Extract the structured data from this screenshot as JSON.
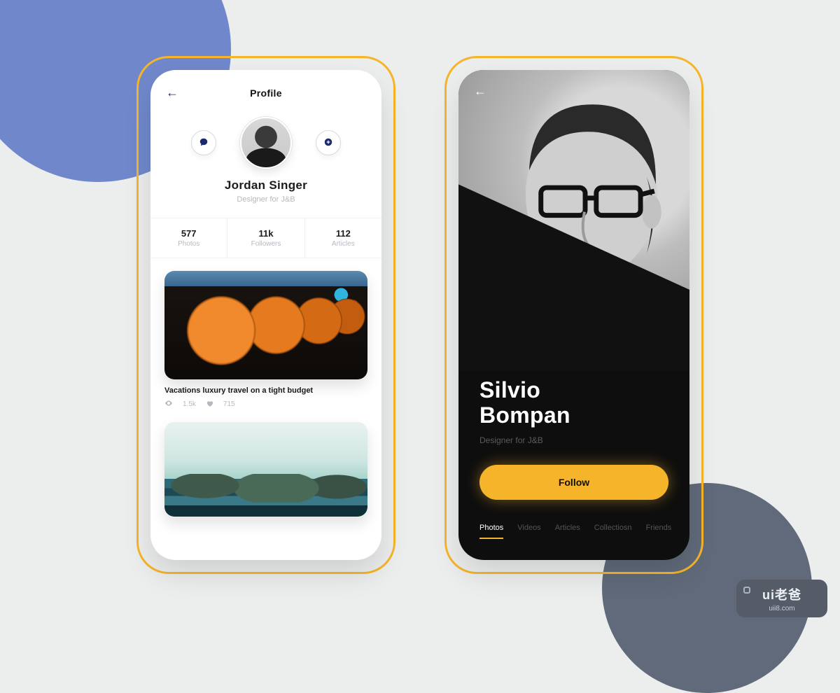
{
  "colors": {
    "accent": "#f6b42a",
    "blue": "#7088cb",
    "slate": "#606a7a"
  },
  "screen1": {
    "header_title": "Profile",
    "name": "Jordan Singer",
    "role": "Designer for J&B",
    "actions": {
      "message_icon": "chat-icon",
      "add_icon": "plus-icon"
    },
    "stats": [
      {
        "value": "577",
        "label": "Photos"
      },
      {
        "value": "11k",
        "label": "Followers"
      },
      {
        "value": "112",
        "label": "Articles"
      }
    ],
    "post": {
      "title": "Vacations luxury travel on a tight budget",
      "views": "1.5k",
      "likes": "715"
    }
  },
  "screen2": {
    "name_line1": "Silvio",
    "name_line2": "Bompan",
    "role": "Designer for J&B",
    "follow_label": "Follow",
    "tabs": [
      "Photos",
      "Videos",
      "Articles",
      "Collectiosn",
      "Friends"
    ]
  },
  "watermark": {
    "title": "ui老爸",
    "sub": "uii8.com"
  }
}
